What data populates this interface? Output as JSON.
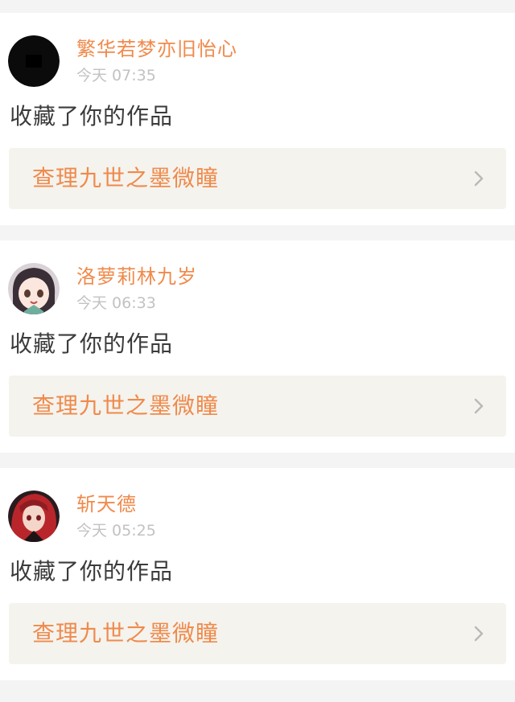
{
  "notifications": [
    {
      "username": "繁华若梦亦旧怡心",
      "time": "今天 07:35",
      "action": "收藏了你的作品",
      "work_title": "查理九世之墨微瞳",
      "avatar": "avatar-black-circle"
    },
    {
      "username": "洛萝莉林九岁",
      "time": "今天 06:33",
      "action": "收藏了你的作品",
      "work_title": "查理九世之墨微瞳",
      "avatar": "avatar-anime-girl"
    },
    {
      "username": "斩天德",
      "time": "今天 05:25",
      "action": "收藏了你的作品",
      "work_title": "查理九世之墨微瞳",
      "avatar": "avatar-red-hair-character"
    }
  ],
  "colors": {
    "accent": "#f08a4b",
    "timestamp": "#c2c2c2",
    "text": "#3b3b3b",
    "link_bg": "#f4f3ee",
    "page_bg": "#f4f4f4"
  }
}
